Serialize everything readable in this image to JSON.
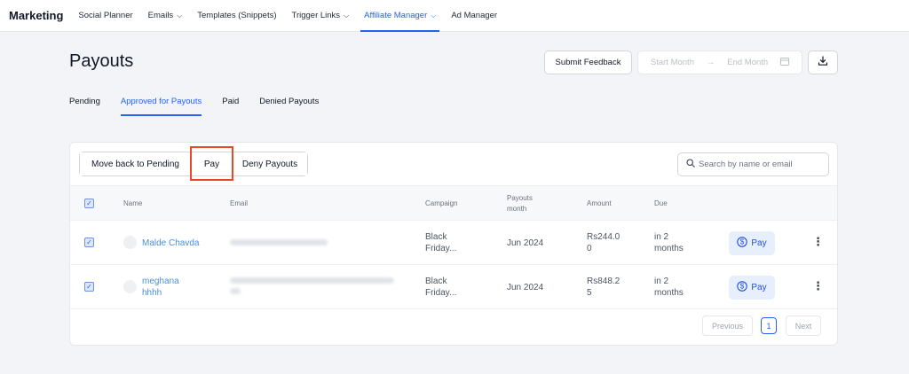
{
  "nav": {
    "brand": "Marketing",
    "items": [
      {
        "label": "Social Planner",
        "caret": false
      },
      {
        "label": "Emails",
        "caret": true
      },
      {
        "label": "Templates (Snippets)",
        "caret": false
      },
      {
        "label": "Trigger Links",
        "caret": true
      },
      {
        "label": "Affiliate Manager",
        "caret": true
      },
      {
        "label": "Ad Manager",
        "caret": false
      }
    ]
  },
  "page": {
    "title": "Payouts",
    "feedback_label": "Submit Feedback",
    "start_placeholder": "Start Month",
    "end_placeholder": "End Month"
  },
  "tabs": [
    "Pending",
    "Approved for Payouts",
    "Paid",
    "Denied Payouts"
  ],
  "actions": {
    "move_back": "Move back to Pending",
    "pay": "Pay",
    "deny": "Deny Payouts",
    "search_placeholder": "Search by name or email"
  },
  "table": {
    "headers": {
      "name": "Name",
      "email": "Email",
      "campaign": "Campaign",
      "payouts_month_1": "Payouts",
      "payouts_month_2": "month",
      "amount": "Amount",
      "due": "Due"
    },
    "rows": [
      {
        "name": "Malde Chavda",
        "name_2": "",
        "campaign_1": "Black",
        "campaign_2": "Friday...",
        "month": "Jun 2024",
        "amount_1": "Rs244.0",
        "amount_2": "0",
        "due_1": "in 2",
        "due_2": "months",
        "pay_label": "Pay"
      },
      {
        "name": "meghana",
        "name_2": "hhhh",
        "campaign_1": "Black",
        "campaign_2": "Friday...",
        "month": "Jun 2024",
        "amount_1": "Rs848.2",
        "amount_2": "5",
        "due_1": "in 2",
        "due_2": "months",
        "pay_label": "Pay"
      }
    ]
  },
  "pagination": {
    "previous": "Previous",
    "current_page": "1",
    "next": "Next"
  },
  "colors": {
    "accent": "#2563eb",
    "highlight_box": "#e8472a",
    "link": "#4a90d9",
    "pay_button_bg": "#e8effc"
  },
  "icons": [
    "chevron-down-icon",
    "arrow-right-icon",
    "calendar-icon",
    "download-icon",
    "search-icon",
    "checkbox-checked-icon",
    "dollar-circle-icon",
    "more-vertical-icon"
  ]
}
